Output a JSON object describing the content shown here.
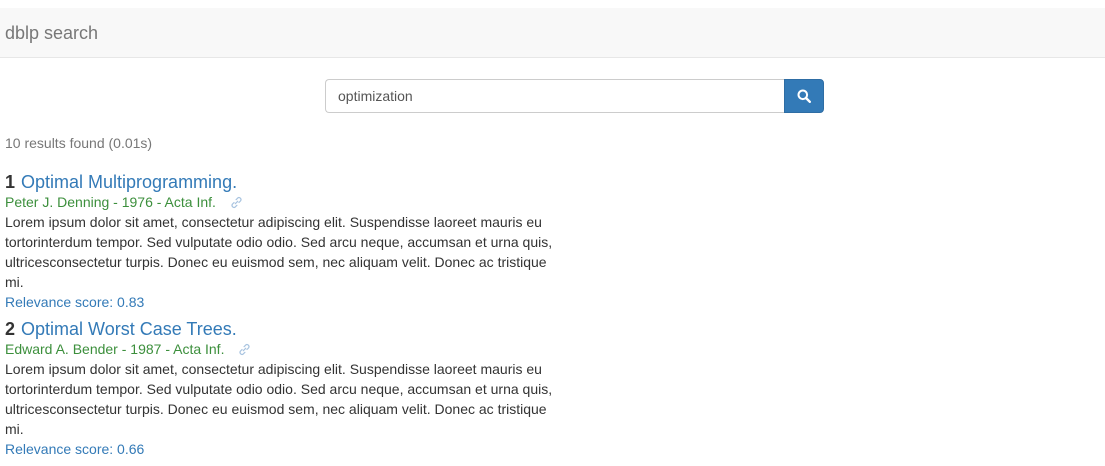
{
  "navbar": {
    "brand": "dblp search"
  },
  "search": {
    "value": "optimization",
    "button_icon": "search-icon"
  },
  "results_count": "10 results found (0.01s)",
  "results": [
    {
      "number": "1",
      "title": "Optimal Multiprogramming.",
      "meta": "Peter J. Denning - 1976 - Acta Inf.",
      "abstract": "Lorem ipsum dolor sit amet, consectetur adipiscing elit. Suspendisse laoreet mauris eu tortorinterdum tempor. Sed vulputate odio odio. Sed arcu neque, accumsan et urna quis, ultricesconsectetur turpis. Donec eu euismod sem, nec aliquam velit. Donec ac tristique mi.",
      "score": "Relevance score: 0.83"
    },
    {
      "number": "2",
      "title": "Optimal Worst Case Trees.",
      "meta": "Edward A. Bender - 1987 - Acta Inf.",
      "abstract": "Lorem ipsum dolor sit amet, consectetur adipiscing elit. Suspendisse laoreet mauris eu tortorinterdum tempor. Sed vulputate odio odio. Sed arcu neque, accumsan et urna quis, ultricesconsectetur turpis. Donec eu euismod sem, nec aliquam velit. Donec ac tristique mi.",
      "score": "Relevance score: 0.66"
    }
  ],
  "colors": {
    "link": "#337ab7",
    "meta": "#3c8f3c",
    "navbar_bg": "#f8f8f8",
    "button": "#337ab7"
  }
}
